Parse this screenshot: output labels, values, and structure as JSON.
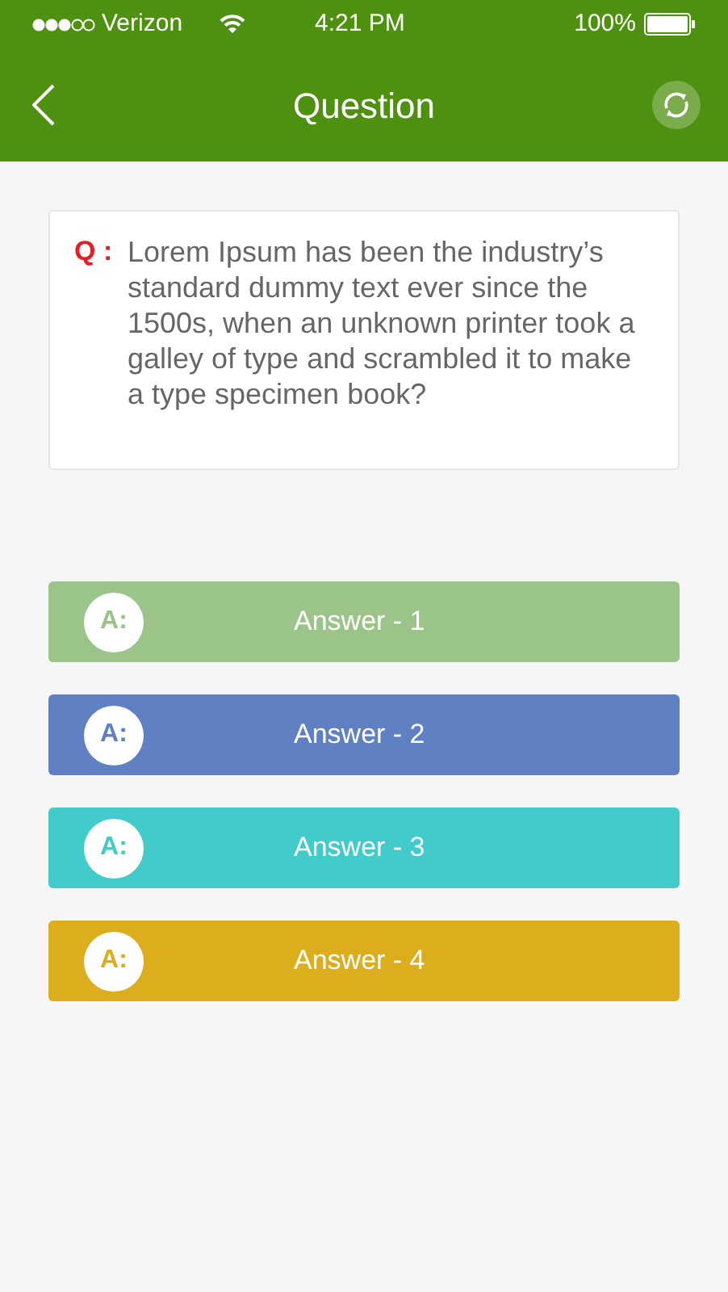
{
  "status_bar": {
    "carrier": "Verizon",
    "time": "4:21 PM",
    "battery": "100%"
  },
  "header": {
    "title": "Question"
  },
  "question": {
    "label": "Q :",
    "text": "Lorem Ipsum has been the industry’s standard dummy text ever since the 1500s, when an unknown printer took a galley of type and scrambled it to make a type specimen book?"
  },
  "answers": [
    {
      "badge": "A:",
      "label": "Answer - 1",
      "color": "#9bc489"
    },
    {
      "badge": "A:",
      "label": "Answer - 2",
      "color": "#5f80c3"
    },
    {
      "badge": "A:",
      "label": "Answer - 3",
      "color": "#41cbca"
    },
    {
      "badge": "A:",
      "label": "Answer - 4",
      "color": "#dcad1d"
    }
  ]
}
